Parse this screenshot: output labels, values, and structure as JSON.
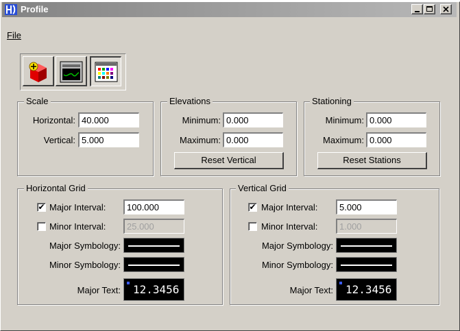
{
  "window": {
    "title": "Profile",
    "minimize_symbol": "_",
    "maximize_symbol": "□",
    "close_symbol": "×"
  },
  "menu": {
    "file": "File"
  },
  "toolbar": {
    "icons": [
      "cube-marker-icon",
      "profile-window-icon",
      "color-palette-icon"
    ],
    "pressed_index": 2
  },
  "scale": {
    "title": "Scale",
    "horizontal_label": "Horizontal:",
    "horizontal_value": "40.000",
    "vertical_label": "Vertical:",
    "vertical_value": "5.000"
  },
  "elevations": {
    "title": "Elevations",
    "minimum_label": "Minimum:",
    "minimum_value": "0.000",
    "maximum_label": "Maximum:",
    "maximum_value": "0.000",
    "reset_label": "Reset Vertical"
  },
  "stationing": {
    "title": "Stationing",
    "minimum_label": "Minimum:",
    "minimum_value": "0.000",
    "maximum_label": "Maximum:",
    "maximum_value": "0.000",
    "reset_label": "Reset Stations"
  },
  "horizontal_grid": {
    "title": "Horizontal Grid",
    "major_interval_label": "Major Interval:",
    "major_interval_value": "100.000",
    "major_checked": true,
    "minor_interval_label": "Minor Interval:",
    "minor_interval_value": "25.000",
    "minor_checked": false,
    "major_symbology_label": "Major Symbology:",
    "minor_symbology_label": "Minor Symbology:",
    "major_text_label": "Major Text:",
    "major_text_sample": "12.3456"
  },
  "vertical_grid": {
    "title": "Vertical Grid",
    "major_interval_label": "Major Interval:",
    "major_interval_value": "5.000",
    "major_checked": true,
    "minor_interval_label": "Minor Interval:",
    "minor_interval_value": "1.000",
    "minor_checked": false,
    "major_symbology_label": "Major Symbology:",
    "minor_symbology_label": "Minor Symbology:",
    "major_text_label": "Major Text:",
    "major_text_sample": "12.3456"
  },
  "colors": {
    "title_gradient_start": "#838383",
    "title_gradient_end": "#b8b8b8",
    "face": "#d4d0c8",
    "swatch_background": "#000000",
    "text_sample_marker": "#3a5bff"
  },
  "checkmark": "✔"
}
